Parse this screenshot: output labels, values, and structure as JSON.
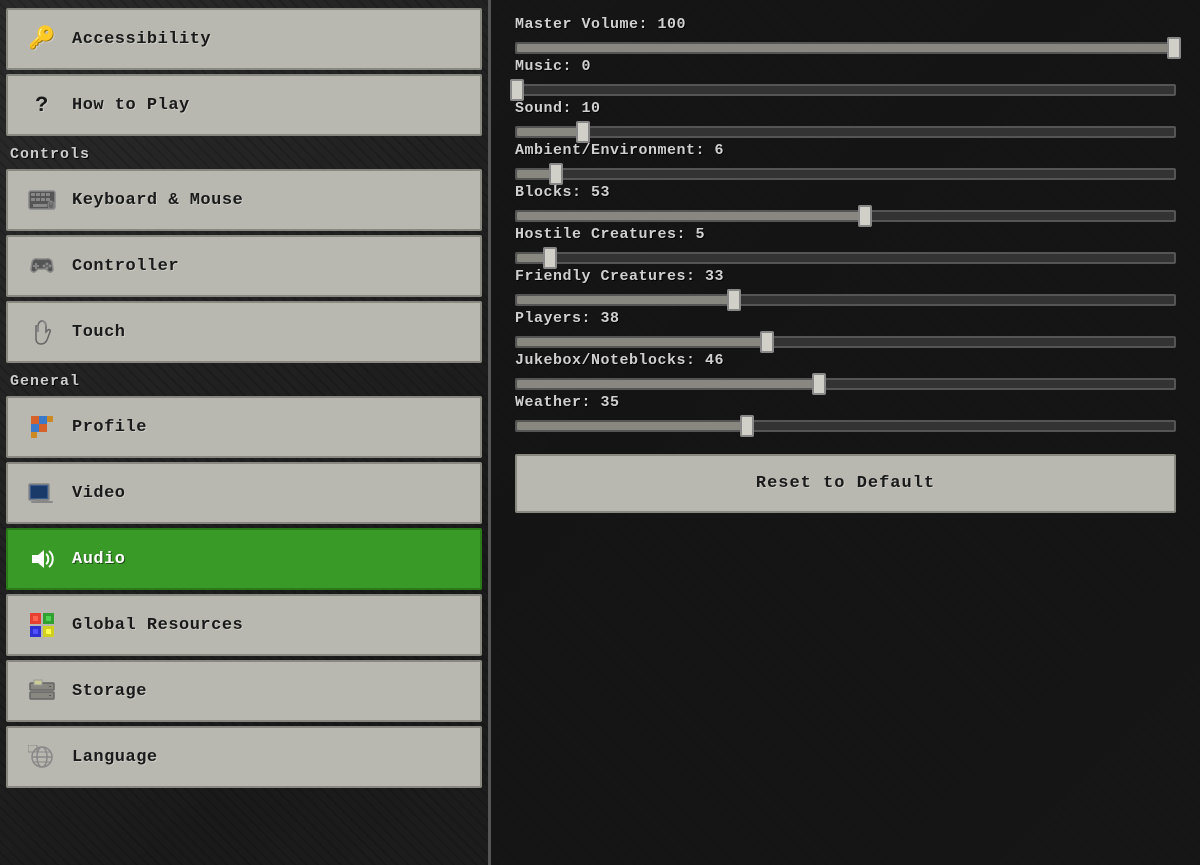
{
  "sidebar": {
    "accessibility_label": "Accessibility",
    "how_to_play_label": "How to Play",
    "controls_section": "Controls",
    "keyboard_mouse_label": "Keyboard & Mouse",
    "controller_label": "Controller",
    "touch_label": "Touch",
    "general_section": "General",
    "profile_label": "Profile",
    "video_label": "Video",
    "audio_label": "Audio",
    "global_resources_label": "Global Resources",
    "storage_label": "Storage",
    "language_label": "Language"
  },
  "icons": {
    "accessibility": "🔑",
    "how_to_play": "?",
    "keyboard": "⌨",
    "controller": "🎮",
    "touch": "🤲",
    "profile": "🧱",
    "video": "📺",
    "audio": "🔊",
    "global_resources": "🎨",
    "storage": "📁",
    "language": "🌐"
  },
  "sliders": [
    {
      "label": "Master Volume",
      "value": 100,
      "percent": 100
    },
    {
      "label": "Music",
      "value": 0,
      "percent": 0
    },
    {
      "label": "Sound",
      "value": 10,
      "percent": 10
    },
    {
      "label": "Ambient/Environment",
      "value": 6,
      "percent": 6
    },
    {
      "label": "Blocks",
      "value": 53,
      "percent": 53
    },
    {
      "label": "Hostile Creatures",
      "value": 5,
      "percent": 5
    },
    {
      "label": "Friendly Creatures",
      "value": 33,
      "percent": 33
    },
    {
      "label": "Players",
      "value": 38,
      "percent": 38
    },
    {
      "label": "Jukebox/Noteblocks",
      "value": 46,
      "percent": 46
    },
    {
      "label": "Weather",
      "value": 35,
      "percent": 35
    }
  ],
  "reset_button_label": "Reset to Default"
}
